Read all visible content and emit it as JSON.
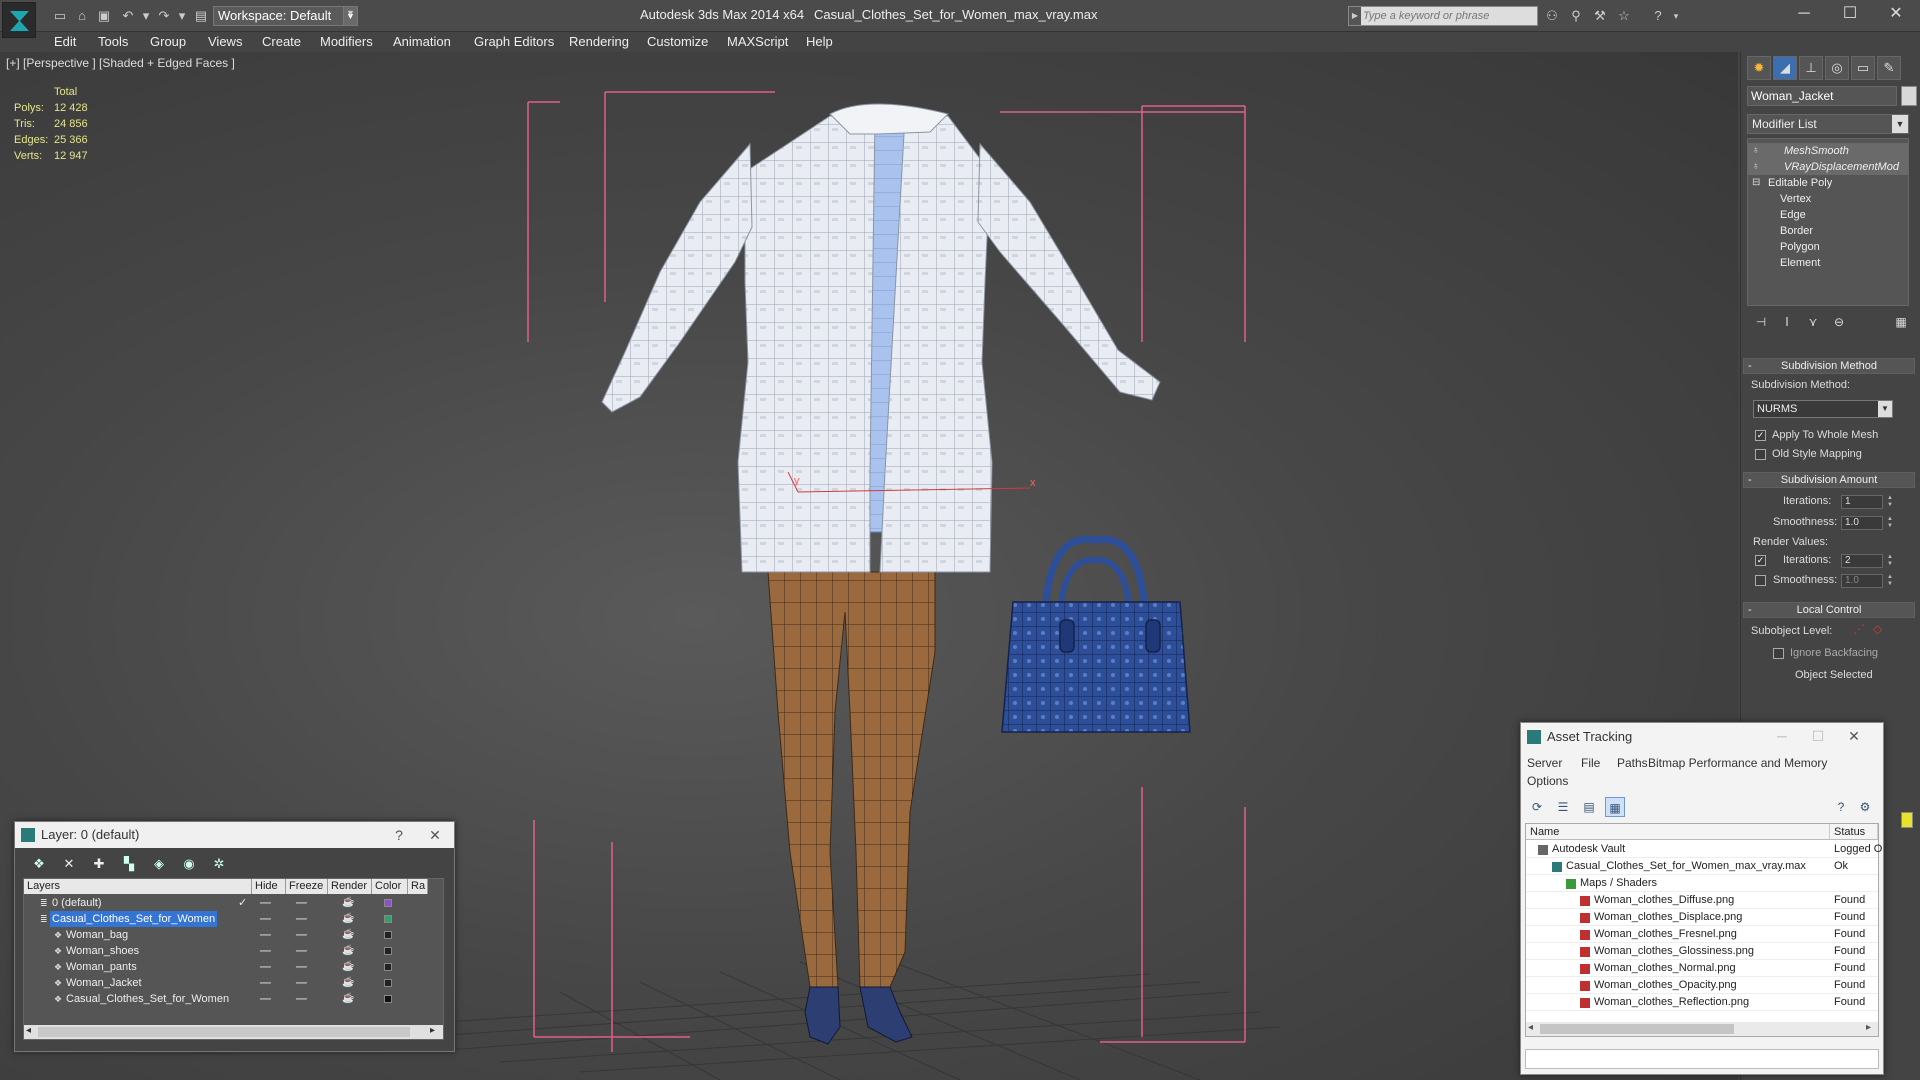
{
  "titlebar": {
    "workspace": "Workspace: Default",
    "app_title": "Autodesk 3ds Max  2014 x64",
    "file_title": "Casual_Clothes_Set_for_Women_max_vray.max",
    "search_placeholder": "Type a keyword or phrase"
  },
  "menu": [
    "Edit",
    "Tools",
    "Group",
    "Views",
    "Create",
    "Modifiers",
    "Animation",
    "Graph Editors",
    "Rendering",
    "Customize",
    "MAXScript",
    "Help"
  ],
  "viewport": {
    "label": "[+] [Perspective ] [Shaded + Edged Faces ]",
    "stats_header": "Total",
    "stats": [
      {
        "label": "Polys:",
        "value": "12 428"
      },
      {
        "label": "Tris:",
        "value": "24 856"
      },
      {
        "label": "Edges:",
        "value": "25 366"
      },
      {
        "label": "Verts:",
        "value": "12 947"
      }
    ],
    "axis_y": "y",
    "axis_x": "x"
  },
  "command_panel": {
    "object_name": "Woman_Jacket",
    "modifier_list": "Modifier List",
    "stack": [
      {
        "label": "MeshSmooth",
        "type": "mod"
      },
      {
        "label": "VRayDisplacementMod",
        "type": "mod"
      },
      {
        "label": "Editable Poly",
        "type": "base"
      },
      {
        "label": "Vertex",
        "type": "sub"
      },
      {
        "label": "Edge",
        "type": "sub"
      },
      {
        "label": "Border",
        "type": "sub"
      },
      {
        "label": "Polygon",
        "type": "sub"
      },
      {
        "label": "Element",
        "type": "sub"
      }
    ],
    "subdivision_method_header": "Subdivision Method",
    "subdivision_method_label": "Subdivision Method:",
    "subdivision_method_value": "NURMS",
    "apply_whole_mesh": "Apply To Whole Mesh",
    "old_style_mapping": "Old Style Mapping",
    "subdivision_amount_header": "Subdivision Amount",
    "iterations_label": "Iterations:",
    "iterations_value": "1",
    "smoothness_label": "Smoothness:",
    "smoothness_value": "1.0",
    "render_values_label": "Render Values:",
    "render_iterations_value": "2",
    "render_smoothness_value": "1.0",
    "local_control_header": "Local Control",
    "subobject_level_label": "Subobject Level:",
    "ignore_backfacing": "Ignore Backfacing",
    "object_selected": "Object Selected"
  },
  "layer_dialog": {
    "title": "Layer: 0 (default)",
    "help": "?",
    "columns": [
      "Layers",
      "Hide",
      "Freeze",
      "Render",
      "Color",
      "Ra"
    ],
    "rows": [
      {
        "name": "0 (default)",
        "indent": 1,
        "color": "#8e4fc9",
        "selected": false,
        "check": "✓"
      },
      {
        "name": "Casual_Clothes_Set_for_Women",
        "indent": 1,
        "color": "#2fa36b",
        "selected": true,
        "check": ""
      },
      {
        "name": "Woman_bag",
        "indent": 2,
        "color": "#222222",
        "selected": false,
        "check": ""
      },
      {
        "name": "Woman_shoes",
        "indent": 2,
        "color": "#222222",
        "selected": false,
        "check": ""
      },
      {
        "name": "Woman_pants",
        "indent": 2,
        "color": "#222222",
        "selected": false,
        "check": ""
      },
      {
        "name": "Woman_Jacket",
        "indent": 2,
        "color": "#222222",
        "selected": false,
        "check": ""
      },
      {
        "name": "Casual_Clothes_Set_for_Women",
        "indent": 2,
        "color": "#111111",
        "selected": false,
        "check": ""
      }
    ]
  },
  "asset_dialog": {
    "title": "Asset Tracking",
    "menu": [
      "Server",
      "File",
      "Paths",
      "Bitmap Performance and Memory",
      "Options"
    ],
    "col_name": "Name",
    "col_status": "Status",
    "rows": [
      {
        "name": "Autodesk Vault",
        "status": "Logged O",
        "indent": 1,
        "icon": "vault"
      },
      {
        "name": "Casual_Clothes_Set_for_Women_max_vray.max",
        "status": "Ok",
        "indent": 2,
        "icon": "max"
      },
      {
        "name": "Maps / Shaders",
        "status": "",
        "indent": 3,
        "icon": "maps"
      },
      {
        "name": "Woman_clothes_Diffuse.png",
        "status": "Found",
        "indent": 4,
        "icon": "png"
      },
      {
        "name": "Woman_clothes_Displace.png",
        "status": "Found",
        "indent": 4,
        "icon": "png"
      },
      {
        "name": "Woman_clothes_Fresnel.png",
        "status": "Found",
        "indent": 4,
        "icon": "png"
      },
      {
        "name": "Woman_clothes_Glossiness.png",
        "status": "Found",
        "indent": 4,
        "icon": "png"
      },
      {
        "name": "Woman_clothes_Normal.png",
        "status": "Found",
        "indent": 4,
        "icon": "png"
      },
      {
        "name": "Woman_clothes_Opacity.png",
        "status": "Found",
        "indent": 4,
        "icon": "png"
      },
      {
        "name": "Woman_clothes_Reflection.png",
        "status": "Found",
        "indent": 4,
        "icon": "png"
      }
    ]
  },
  "colors": {
    "accent": "#3374d4",
    "selection_box": "#e0608a",
    "stats_text": "#e5e58a",
    "pants": "#9a6a3e",
    "bag": "#2d4f9a",
    "jacket": "#e8ecf2",
    "shirt": "#a9c3ee"
  }
}
